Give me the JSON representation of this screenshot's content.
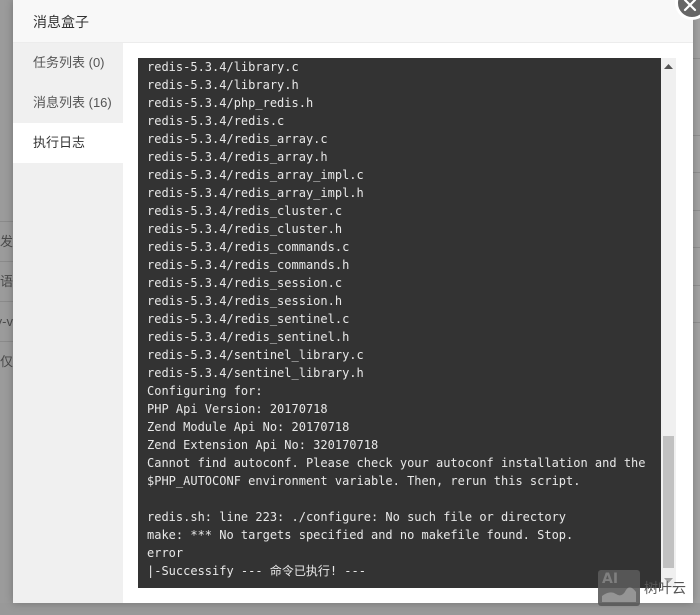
{
  "background": {
    "rows": [
      "开发",
      "程语",
      "y-v",
      "仅"
    ]
  },
  "modal": {
    "title": "消息盒子",
    "close_icon": "close-icon"
  },
  "sidebar": {
    "items": [
      {
        "label": "任务列表 (0)",
        "active": false
      },
      {
        "label": "消息列表 (16)",
        "active": false
      },
      {
        "label": "执行日志",
        "active": true
      }
    ]
  },
  "log": {
    "lines": [
      "redis-5.3.4/library.c",
      "redis-5.3.4/library.h",
      "redis-5.3.4/php_redis.h",
      "redis-5.3.4/redis.c",
      "redis-5.3.4/redis_array.c",
      "redis-5.3.4/redis_array.h",
      "redis-5.3.4/redis_array_impl.c",
      "redis-5.3.4/redis_array_impl.h",
      "redis-5.3.4/redis_cluster.c",
      "redis-5.3.4/redis_cluster.h",
      "redis-5.3.4/redis_commands.c",
      "redis-5.3.4/redis_commands.h",
      "redis-5.3.4/redis_session.c",
      "redis-5.3.4/redis_session.h",
      "redis-5.3.4/redis_sentinel.c",
      "redis-5.3.4/redis_sentinel.h",
      "redis-5.3.4/sentinel_library.c",
      "redis-5.3.4/sentinel_library.h",
      "Configuring for:",
      "PHP Api Version: 20170718",
      "Zend Module Api No: 20170718",
      "Zend Extension Api No: 320170718",
      "Cannot find autoconf. Please check your autoconf installation and the",
      "$PHP_AUTOCONF environment variable. Then, rerun this script.",
      "",
      "redis.sh: line 223: ./configure: No such file or directory",
      "make: *** No targets specified and no makefile found. Stop.",
      "error",
      "|-Successify --- 命令已执行! ---"
    ],
    "scroll_position": 0.96
  },
  "watermark": {
    "logo_text": "AI",
    "text": "树叶云"
  },
  "colors": {
    "terminal_bg": "#333333",
    "terminal_fg": "#e8e8e8",
    "sidebar_bg": "#f0f0f0",
    "header_bg": "#f8f8f8"
  }
}
